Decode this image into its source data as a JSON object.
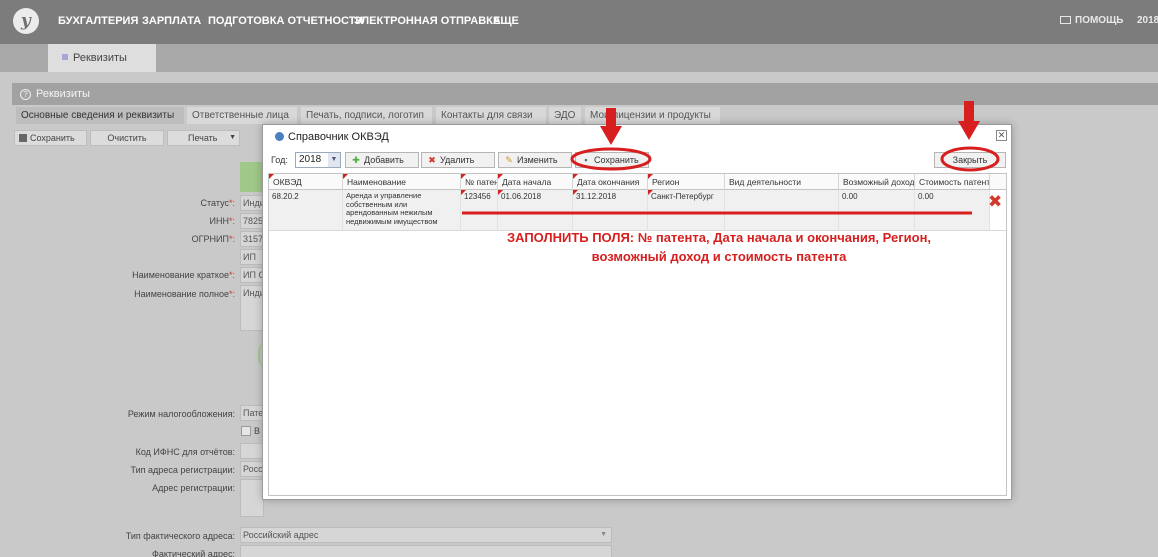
{
  "app": {
    "logo_letter": "у",
    "nav": [
      "БУХГАЛТЕРИЯ",
      "ЗАРПЛАТА",
      "ПОДГОТОВКА ОТЧЕТНОСТИ",
      "ЭЛЕКТРОННАЯ ОТПРАВКА",
      "ЕЩЕ"
    ],
    "help_label": "ПОМОЩЬ",
    "year_label": "2018"
  },
  "doc_tab": "Реквизиты",
  "panel": {
    "title": "Реквизиты",
    "tabs": [
      "Основные сведения и реквизиты",
      "Ответственные лица",
      "Печать, подписи, логотип",
      "Контакты для связи",
      "ЭДО",
      "Мои лицензии и продукты"
    ],
    "toolbar": {
      "save": "Сохранить",
      "clear": "Очистить",
      "print": "Печать"
    }
  },
  "form": {
    "status_label": "Статус",
    "status_value": "Инди",
    "inn_label": "ИНН",
    "inn_value": "7825",
    "ogrnip_label": "ОГРНИП",
    "ogrnip_value": "3157",
    "ip_value": "ИП",
    "short_name_label": "Наименование краткое",
    "short_name_value": "ИП С",
    "full_name_label": "Наименование полное",
    "full_name_value": "Инди",
    "tax_mode_label": "Режим налогообложения:",
    "tax_mode_value": "Пате",
    "tax_checkbox_label": "В",
    "ifns_label": "Код ИФНС для отчётов:",
    "reg_addr_type_label": "Тип адреса регистрации:",
    "reg_addr_type_value": "Росси",
    "reg_addr_label": "Адрес регистрации:",
    "fact_addr_type_label": "Тип фактического адреса:",
    "fact_addr_type_value": "Российский адрес",
    "fact_addr_label": "Фактический адрес:"
  },
  "modal": {
    "title": "Справочник ОКВЭД",
    "year_label": "Год:",
    "year_value": "2018",
    "buttons": {
      "add": "Добавить",
      "delete": "Удалить",
      "edit": "Изменить",
      "save": "Сохранить",
      "close": "Закрыть"
    },
    "columns": [
      "ОКВЭД",
      "Наименование",
      "№ патента",
      "Дата начала",
      "Дата окончания",
      "Регион",
      "Вид деятельности",
      "Возможный доход",
      "Стоимость патента"
    ],
    "rows": [
      {
        "okved": "68.20.2",
        "name": "Аренда и управление собственным или арендованным нежилым недвижимым имуществом",
        "patent_no": "123456",
        "date_start": "01.06.2018",
        "date_end": "31.12.2018",
        "region": "Санкт-Петербург",
        "activity": "",
        "income": "0.00",
        "cost": "0.00"
      }
    ]
  },
  "annotation": {
    "line1": "ЗАПОЛНИТЬ ПОЛЯ: № патента, Дата начала и окончания, Регион,",
    "line2": "возможный доход и стоимость патента",
    "color": "#d71f1f"
  }
}
